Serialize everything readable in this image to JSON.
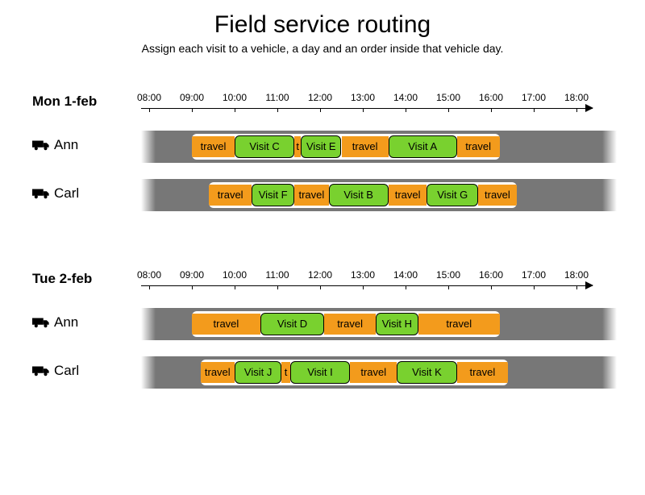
{
  "title": "Field service routing",
  "subtitle": "Assign each visit to a vehicle, a day and an order inside that vehicle day.",
  "hours": [
    "08:00",
    "09:00",
    "10:00",
    "11:00",
    "12:00",
    "13:00",
    "14:00",
    "15:00",
    "16:00",
    "17:00",
    "18:00"
  ],
  "days": [
    {
      "label": "Mon 1-feb",
      "rows": [
        {
          "driver": "Ann",
          "window_start": 9.0,
          "window_end": 16.2,
          "segments": [
            {
              "kind": "travel",
              "label": "travel",
              "start": 9.0,
              "end": 10.0
            },
            {
              "kind": "visit",
              "label": "Visit C",
              "start": 10.0,
              "end": 11.4
            },
            {
              "kind": "travel",
              "label": "t",
              "start": 11.4,
              "end": 11.55
            },
            {
              "kind": "visit",
              "label": "Visit E",
              "start": 11.55,
              "end": 12.5
            },
            {
              "kind": "travel",
              "label": "travel",
              "start": 12.5,
              "end": 13.6
            },
            {
              "kind": "visit",
              "label": "Visit A",
              "start": 13.6,
              "end": 15.2
            },
            {
              "kind": "travel",
              "label": "travel",
              "start": 15.2,
              "end": 16.2
            }
          ]
        },
        {
          "driver": "Carl",
          "window_start": 9.4,
          "window_end": 16.6,
          "segments": [
            {
              "kind": "travel",
              "label": "travel",
              "start": 9.4,
              "end": 10.4
            },
            {
              "kind": "visit",
              "label": "Visit F",
              "start": 10.4,
              "end": 11.4
            },
            {
              "kind": "travel",
              "label": "travel",
              "start": 11.4,
              "end": 12.2
            },
            {
              "kind": "visit",
              "label": "Visit B",
              "start": 12.2,
              "end": 13.6
            },
            {
              "kind": "travel",
              "label": "travel",
              "start": 13.6,
              "end": 14.5
            },
            {
              "kind": "visit",
              "label": "Visit G",
              "start": 14.5,
              "end": 15.7
            },
            {
              "kind": "travel",
              "label": "travel",
              "start": 15.7,
              "end": 16.6
            }
          ]
        }
      ]
    },
    {
      "label": "Tue 2-feb",
      "rows": [
        {
          "driver": "Ann",
          "window_start": 9.0,
          "window_end": 16.2,
          "segments": [
            {
              "kind": "travel",
              "label": "travel",
              "start": 9.0,
              "end": 10.6
            },
            {
              "kind": "visit",
              "label": "Visit D",
              "start": 10.6,
              "end": 12.1
            },
            {
              "kind": "travel",
              "label": "travel",
              "start": 12.1,
              "end": 13.3
            },
            {
              "kind": "visit",
              "label": "Visit H",
              "start": 13.3,
              "end": 14.3
            },
            {
              "kind": "travel",
              "label": "travel",
              "start": 14.3,
              "end": 16.2
            }
          ]
        },
        {
          "driver": "Carl",
          "window_start": 9.2,
          "window_end": 16.4,
          "segments": [
            {
              "kind": "travel",
              "label": "travel",
              "start": 9.2,
              "end": 10.0
            },
            {
              "kind": "visit",
              "label": "Visit J",
              "start": 10.0,
              "end": 11.1
            },
            {
              "kind": "travel",
              "label": "t",
              "start": 11.1,
              "end": 11.3
            },
            {
              "kind": "visit",
              "label": "Visit I",
              "start": 11.3,
              "end": 12.7
            },
            {
              "kind": "travel",
              "label": "travel",
              "start": 12.7,
              "end": 13.8
            },
            {
              "kind": "visit",
              "label": "Visit K",
              "start": 13.8,
              "end": 15.2
            },
            {
              "kind": "travel",
              "label": "travel",
              "start": 15.2,
              "end": 16.4
            }
          ]
        }
      ]
    }
  ],
  "chart_data": {
    "type": "gantt",
    "title": "Field service routing",
    "x_axis": {
      "unit": "hour",
      "start": 8,
      "end": 18,
      "ticks": [
        8,
        9,
        10,
        11,
        12,
        13,
        14,
        15,
        16,
        17,
        18
      ]
    },
    "days": [
      {
        "date": "Mon 1-feb",
        "vehicles": [
          {
            "name": "Ann",
            "segments": [
              {
                "type": "travel",
                "start": 9.0,
                "end": 10.0
              },
              {
                "type": "visit",
                "name": "Visit C",
                "start": 10.0,
                "end": 11.4
              },
              {
                "type": "travel",
                "start": 11.4,
                "end": 11.55
              },
              {
                "type": "visit",
                "name": "Visit E",
                "start": 11.55,
                "end": 12.5
              },
              {
                "type": "travel",
                "start": 12.5,
                "end": 13.6
              },
              {
                "type": "visit",
                "name": "Visit A",
                "start": 13.6,
                "end": 15.2
              },
              {
                "type": "travel",
                "start": 15.2,
                "end": 16.2
              }
            ]
          },
          {
            "name": "Carl",
            "segments": [
              {
                "type": "travel",
                "start": 9.4,
                "end": 10.4
              },
              {
                "type": "visit",
                "name": "Visit F",
                "start": 10.4,
                "end": 11.4
              },
              {
                "type": "travel",
                "start": 11.4,
                "end": 12.2
              },
              {
                "type": "visit",
                "name": "Visit B",
                "start": 12.2,
                "end": 13.6
              },
              {
                "type": "travel",
                "start": 13.6,
                "end": 14.5
              },
              {
                "type": "visit",
                "name": "Visit G",
                "start": 14.5,
                "end": 15.7
              },
              {
                "type": "travel",
                "start": 15.7,
                "end": 16.6
              }
            ]
          }
        ]
      },
      {
        "date": "Tue 2-feb",
        "vehicles": [
          {
            "name": "Ann",
            "segments": [
              {
                "type": "travel",
                "start": 9.0,
                "end": 10.6
              },
              {
                "type": "visit",
                "name": "Visit D",
                "start": 10.6,
                "end": 12.1
              },
              {
                "type": "travel",
                "start": 12.1,
                "end": 13.3
              },
              {
                "type": "visit",
                "name": "Visit H",
                "start": 13.3,
                "end": 14.3
              },
              {
                "type": "travel",
                "start": 14.3,
                "end": 16.2
              }
            ]
          },
          {
            "name": "Carl",
            "segments": [
              {
                "type": "travel",
                "start": 9.2,
                "end": 10.0
              },
              {
                "type": "visit",
                "name": "Visit J",
                "start": 10.0,
                "end": 11.1
              },
              {
                "type": "travel",
                "start": 11.1,
                "end": 11.3
              },
              {
                "type": "visit",
                "name": "Visit I",
                "start": 11.3,
                "end": 12.7
              },
              {
                "type": "travel",
                "start": 12.7,
                "end": 13.8
              },
              {
                "type": "visit",
                "name": "Visit K",
                "start": 13.8,
                "end": 15.2
              },
              {
                "type": "travel",
                "start": 15.2,
                "end": 16.4
              }
            ]
          }
        ]
      }
    ]
  }
}
